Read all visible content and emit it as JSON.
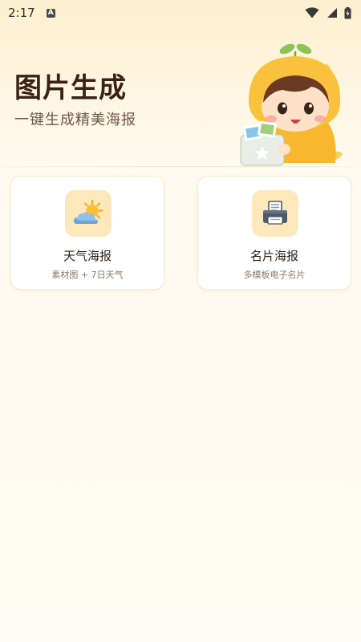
{
  "status_bar": {
    "time": "2:17",
    "notification_badge": "A",
    "icons": [
      "wifi-icon",
      "signal-icon",
      "battery-charging-icon"
    ]
  },
  "hero": {
    "title": "图片生成",
    "subtitle": "一键生成精美海报",
    "illustration": "mascot-illustration"
  },
  "cards": [
    {
      "title": "天气海报",
      "subtitle": "素材图 + 7日天气",
      "icon": "weather-icon"
    },
    {
      "title": "名片海报",
      "subtitle": "多模板电子名片",
      "icon": "card-printer-icon"
    }
  ],
  "colors": {
    "background_top": "#fdf0cf",
    "background_bottom": "#fffcf5",
    "title_text": "#3b2314",
    "icon_tile": "#fde8bc",
    "card_background": "#ffffff"
  }
}
